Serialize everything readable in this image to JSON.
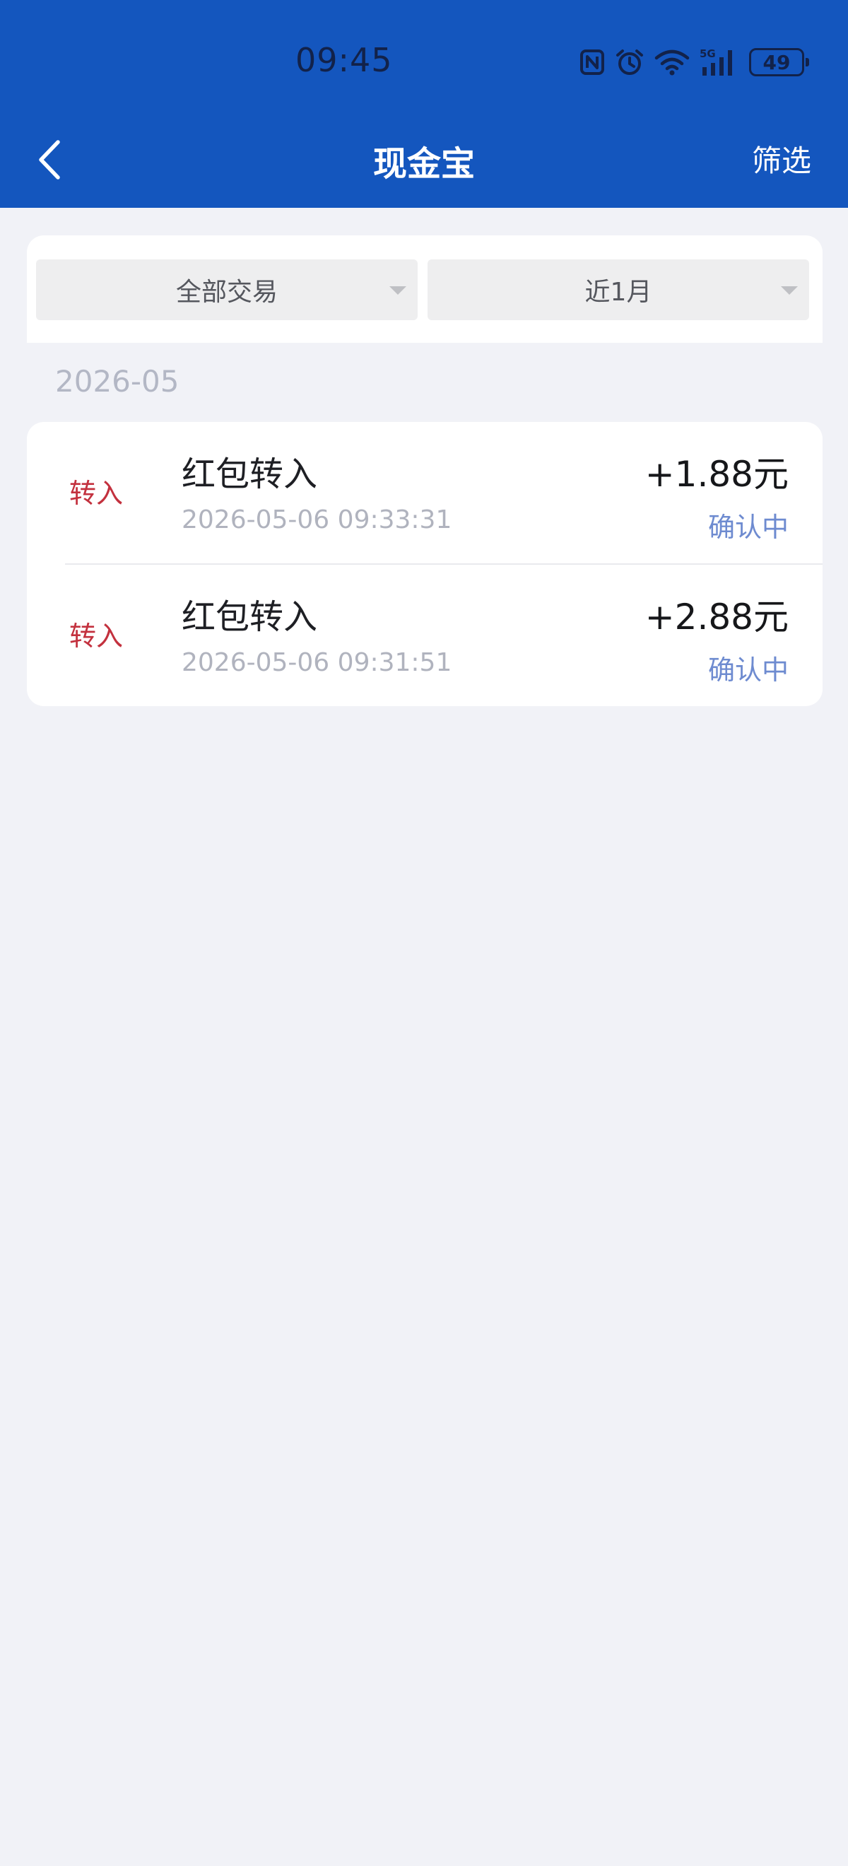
{
  "status_bar": {
    "time": "09:45",
    "battery": "49",
    "network": "5G",
    "icons": [
      "nfc-icon",
      "alarm-icon",
      "wifi-icon",
      "signal-5g-icon",
      "battery-icon"
    ]
  },
  "nav": {
    "title": "现金宝",
    "filter_label": "筛选",
    "back_icon": "chevron-left-icon"
  },
  "filters": {
    "type": {
      "selected": "全部交易"
    },
    "period": {
      "selected": "近1月"
    }
  },
  "month_label": "2026-05",
  "transactions": [
    {
      "type": "转入",
      "title": "红包转入",
      "datetime": "2026-05-06 09:33:31",
      "amount": "+1.88元",
      "status": "确认中"
    },
    {
      "type": "转入",
      "title": "红包转入",
      "datetime": "2026-05-06 09:31:51",
      "amount": "+2.88元",
      "status": "确认中"
    }
  ],
  "colors": {
    "brand_blue": "#1456BE",
    "page_background": "#F1F2F7",
    "inflow_red": "#C3313E",
    "status_blue": "#6E8BD0"
  }
}
